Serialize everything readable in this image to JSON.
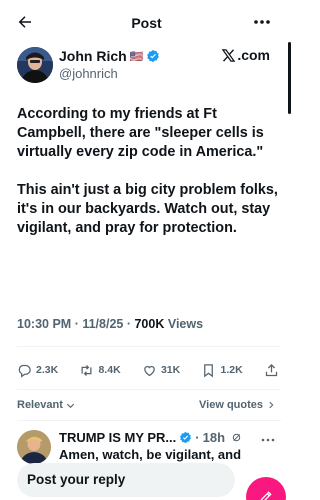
{
  "topbar": {
    "title": "Post",
    "back_icon": "back-arrow-icon",
    "more_icon": "more-horizontal-icon"
  },
  "author": {
    "name": "John Rich",
    "flag": "🇺🇸",
    "handle": "@johnrich",
    "verified_icon": "verified-badge-icon",
    "affiliate": ".com",
    "affiliate_icon": "x-logo-icon"
  },
  "post": {
    "paragraphs": [
      "According to my friends at Ft Campbell, there are \"sleeper cells is virtually every zip code in America.\"",
      "This ain't just a big city problem folks, it's in our backyards. Watch out, stay vigilant, and pray for protection."
    ],
    "time": "10:30 PM",
    "date": "11/8/25",
    "views_count": "700K",
    "views_label": "Views"
  },
  "actions": {
    "replies": "2.3K",
    "reposts": "8.4K",
    "likes": "31K",
    "bookmarks": "1.2K"
  },
  "sort": {
    "label": "Relevant",
    "view_quotes": "View quotes"
  },
  "reply": {
    "name": "TRUMP IS MY PR...",
    "time": "18h",
    "text": "Amen, watch, be vigilant, and"
  },
  "compose": {
    "placeholder": "Post your reply"
  },
  "colors": {
    "accent": "#1d9bf0",
    "fab": "#f91880",
    "muted": "#536471",
    "text": "#0f1419"
  }
}
